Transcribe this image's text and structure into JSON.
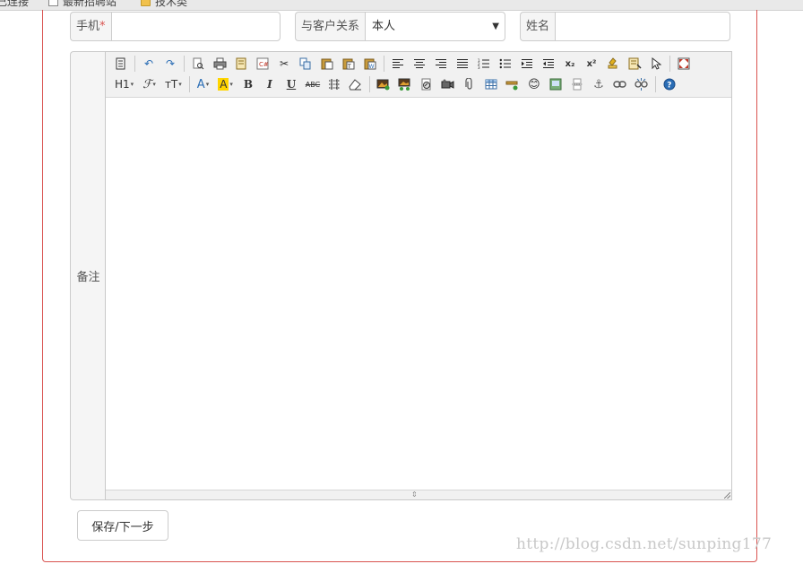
{
  "browser": {
    "bookmarks": [
      {
        "label": "己连接",
        "icon": "page-icon"
      },
      {
        "label": "最新招聘站",
        "icon": "page-icon"
      },
      {
        "label": "技术类",
        "icon": "folder-icon"
      }
    ]
  },
  "form": {
    "phone": {
      "label": "手机",
      "required_mark": "*",
      "value": ""
    },
    "relation": {
      "label": "与客户关系",
      "selected": "本人"
    },
    "name": {
      "label": "姓名",
      "value": ""
    },
    "remark": {
      "label": "备注"
    }
  },
  "editor": {
    "toolbar_row1": [
      "source",
      "undo",
      "redo",
      "preview",
      "print",
      "template",
      "code",
      "cut",
      "copy",
      "paste",
      "paste-text",
      "paste-word",
      "align-left",
      "align-center",
      "align-right",
      "align-justify",
      "ordered-list",
      "unordered-list",
      "indent",
      "outdent",
      "subscript",
      "superscript",
      "clear-format",
      "select-all",
      "select",
      "fullscreen"
    ],
    "toolbar_row2": [
      "heading",
      "font-family",
      "font-size",
      "font-color",
      "highlight",
      "bold",
      "italic",
      "underline",
      "strikethrough",
      "line-height",
      "remove-format",
      "image",
      "multi-image",
      "flash",
      "media",
      "attachment",
      "table",
      "horizontal-rule",
      "emoticon",
      "map",
      "page-break",
      "anchor",
      "link",
      "unlink",
      "help"
    ],
    "heading_label": "H1",
    "fontsize_label": "тT",
    "bold_label": "B",
    "italic_label": "I",
    "underline_label": "U",
    "strike_label": "ABC",
    "fontcolor_label": "A",
    "highlight_label": "A",
    "sub_label": "x₂",
    "sup_label": "x²",
    "content": ""
  },
  "actions": {
    "save_label": "保存/下一步"
  },
  "watermark": "http://blog.csdn.net/sunping177"
}
